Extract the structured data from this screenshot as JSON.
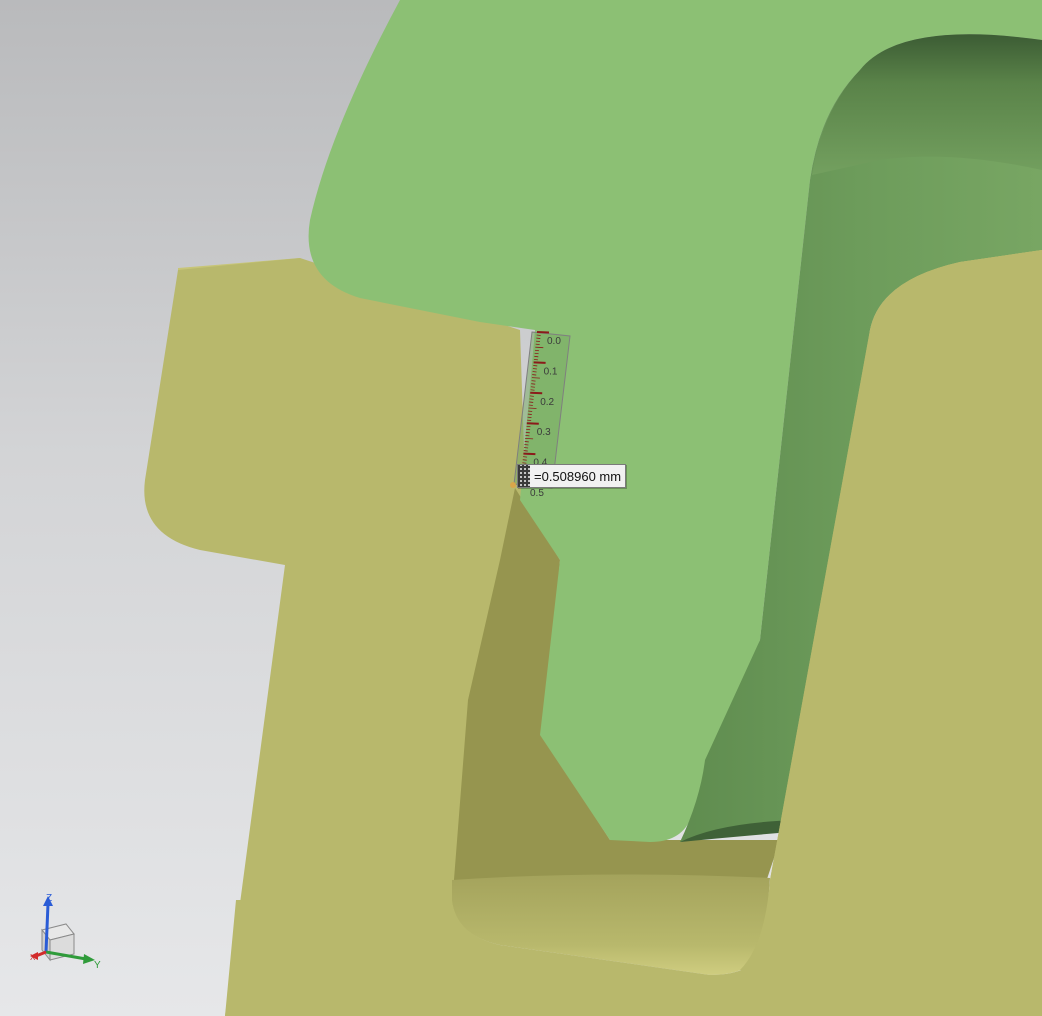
{
  "viewport": {
    "background_top": "#b9babc",
    "background_bottom": "#e6e7e9"
  },
  "model": {
    "housing_color": "#b8b86c",
    "housing_top_color": "#c7c577",
    "housing_shadow_color": "#96954f",
    "clip_color": "#8cc074",
    "clip_inner_color": "#6c9a5a",
    "clip_dark_color": "#3f6137"
  },
  "measurement": {
    "value_text": "=0.508960 mm",
    "scale_labels": [
      "0.0",
      "0.1",
      "0.2",
      "0.3",
      "0.4",
      "0.5"
    ],
    "scale_color": "#8b1a1a"
  },
  "triad": {
    "z_label": "Z",
    "y_label": "Y",
    "x_label": "X",
    "z_color": "#2a5cd6",
    "y_color": "#2f9b3a",
    "x_color": "#d22b2b"
  }
}
